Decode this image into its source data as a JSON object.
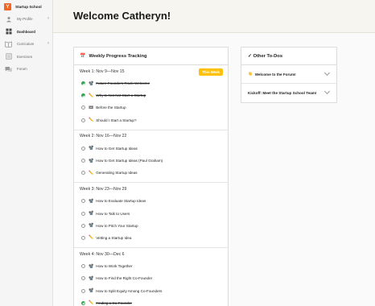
{
  "sidebar": {
    "brand": {
      "logo_letter": "Y",
      "name": "Startup School",
      "logo_color": "#f26522"
    },
    "items": [
      {
        "label": "My Profile",
        "icon": "person-icon",
        "has_chevron": true,
        "active": false
      },
      {
        "label": "Dashboard",
        "icon": "dashboard-icon",
        "has_chevron": false,
        "active": true
      },
      {
        "label": "Curriculum",
        "icon": "book-icon",
        "has_chevron": true,
        "active": false
      },
      {
        "label": "Exercises",
        "icon": "exercise-icon",
        "has_chevron": false,
        "active": false
      },
      {
        "label": "Forum",
        "icon": "chat-icon",
        "has_chevron": false,
        "active": false
      }
    ]
  },
  "header": {
    "title": "Welcome Catheryn!"
  },
  "progress": {
    "title_icon": "📅",
    "title": "Weekly Progress Tracking",
    "weeks": [
      {
        "label": "Week 1: Nov 9—Nov 15",
        "badge": "This Week",
        "lessons": [
          {
            "icon": "📽️",
            "title": "Future Founders Track Welcome",
            "done": true
          },
          {
            "icon": "✏️",
            "title": "Why to Not Not Start a Startup",
            "done": true
          },
          {
            "icon": "📼",
            "title": "Before the Startup",
            "done": false
          },
          {
            "icon": "✏️",
            "title": "Should I Start a Startup?",
            "done": false
          }
        ]
      },
      {
        "label": "Week 2: Nov 16—Nov 22",
        "badge": "",
        "lessons": [
          {
            "icon": "📽️",
            "title": "How to Get Startup Ideas",
            "done": false
          },
          {
            "icon": "📽️",
            "title": "How to Get Startup Ideas (Paul Graham)",
            "done": false
          },
          {
            "icon": "✏️",
            "title": "Generating Startup Ideas",
            "done": false
          }
        ]
      },
      {
        "label": "Week 3: Nov 23—Nov 29",
        "badge": "",
        "lessons": [
          {
            "icon": "📽️",
            "title": "How to Evaluate Startup Ideas",
            "done": false
          },
          {
            "icon": "📽️",
            "title": "How to Talk to Users",
            "done": false
          },
          {
            "icon": "📽️",
            "title": "How to Pitch Your Startup",
            "done": false
          },
          {
            "icon": "✏️",
            "title": "Vetting a Startup Idea",
            "done": false
          }
        ]
      },
      {
        "label": "Week 4: Nov 30—Dec 6",
        "badge": "",
        "lessons": [
          {
            "icon": "📽️",
            "title": "How to Work Together",
            "done": false
          },
          {
            "icon": "📽️",
            "title": "How to Find the Right Co-Founder",
            "done": false
          },
          {
            "icon": "📽️",
            "title": "How to Split Equity Among Co-Founders",
            "done": false
          },
          {
            "icon": "✏️",
            "title": "Finding a Co-Founder",
            "done": true
          }
        ]
      }
    ]
  },
  "todos": {
    "title": "✓ Other To-Dos",
    "items": [
      {
        "icon": "👋",
        "label": "Welcome to the Forum!"
      },
      {
        "icon": "",
        "label": "Kickoff: Meet the Startup School Team!"
      }
    ]
  },
  "colors": {
    "accent": "#f26522",
    "badge": "#ffc107",
    "done": "#2fa84f"
  }
}
